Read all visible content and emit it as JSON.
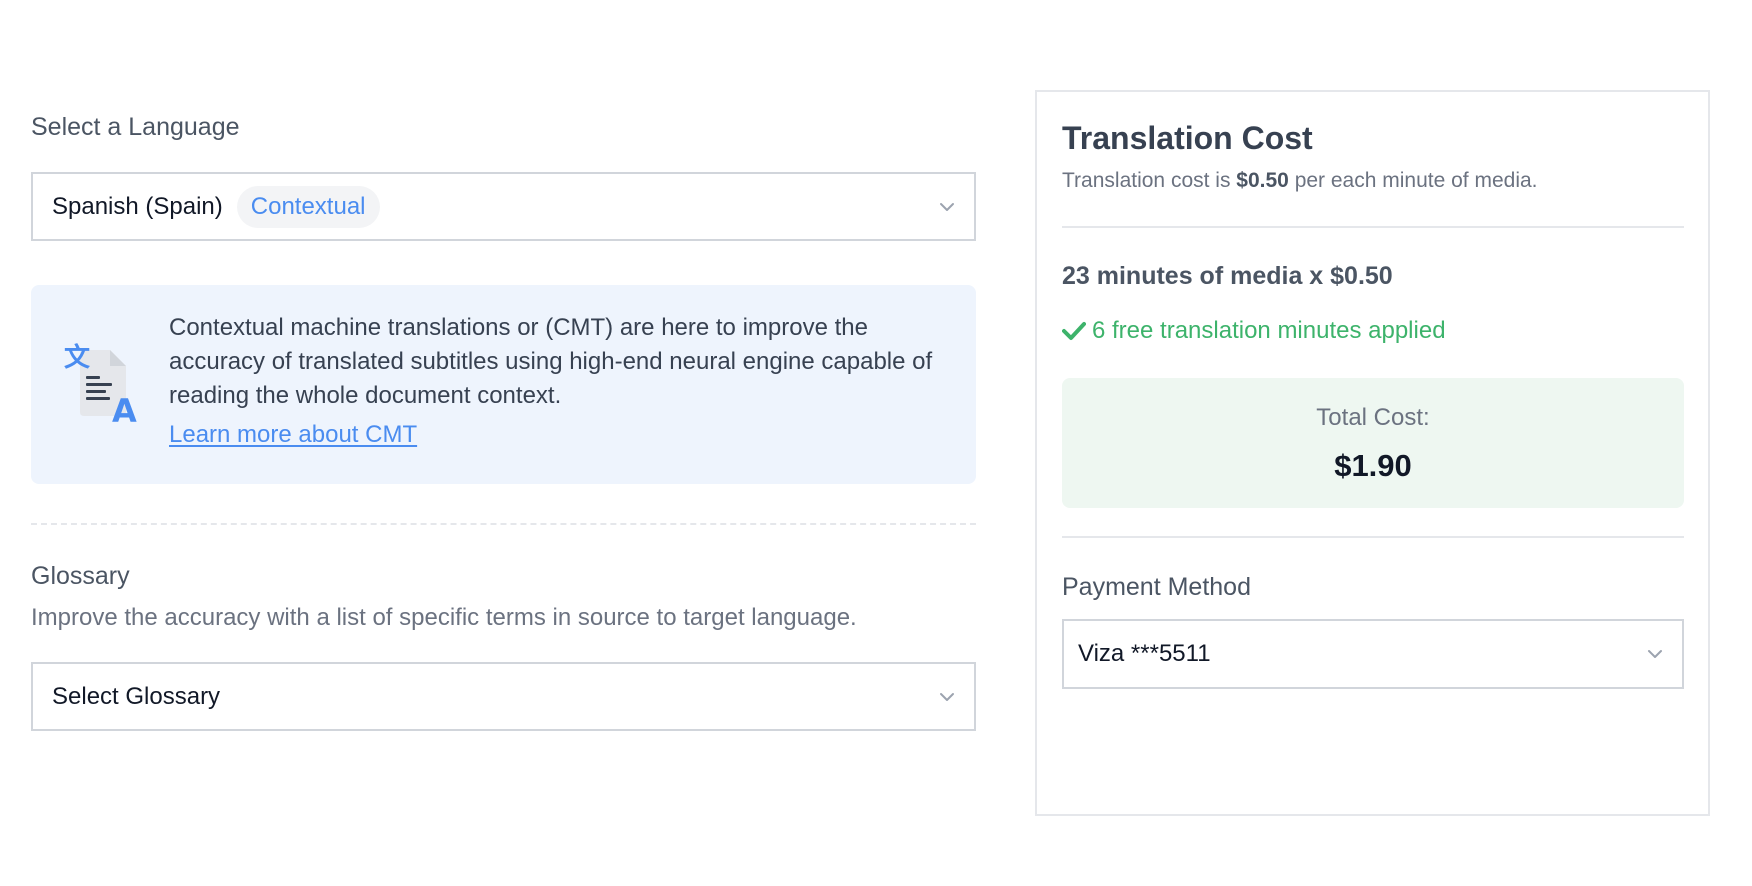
{
  "language": {
    "label": "Select a Language",
    "selected": "Spanish (Spain)",
    "badge": "Contextual"
  },
  "cmt_info": {
    "text": "Contextual machine translations or (CMT) are here to improve the accuracy of translated subtitles using high-end neural engine capable of reading the whole document context.",
    "link": "Learn more about CMT",
    "icon": "translate-document-icon"
  },
  "glossary": {
    "label": "Glossary",
    "description": "Improve the accuracy with a list of specific terms in source to target language.",
    "selected": "Select Glossary"
  },
  "cost": {
    "title": "Translation Cost",
    "subtitle_prefix": "Translation cost is ",
    "subtitle_rate": "$0.50",
    "subtitle_suffix": " per each minute of media.",
    "minutes_line": "23 minutes of media x $0.50",
    "free_minutes": "6 free translation minutes applied",
    "total_label": "Total Cost:",
    "total_value": "$1.90"
  },
  "payment": {
    "label": "Payment Method",
    "selected": "Viza ***5511"
  },
  "colors": {
    "accent": "#4a8cf0",
    "success": "#3db36b",
    "info_bg": "#eef4fd",
    "total_bg": "#eef7f1"
  }
}
